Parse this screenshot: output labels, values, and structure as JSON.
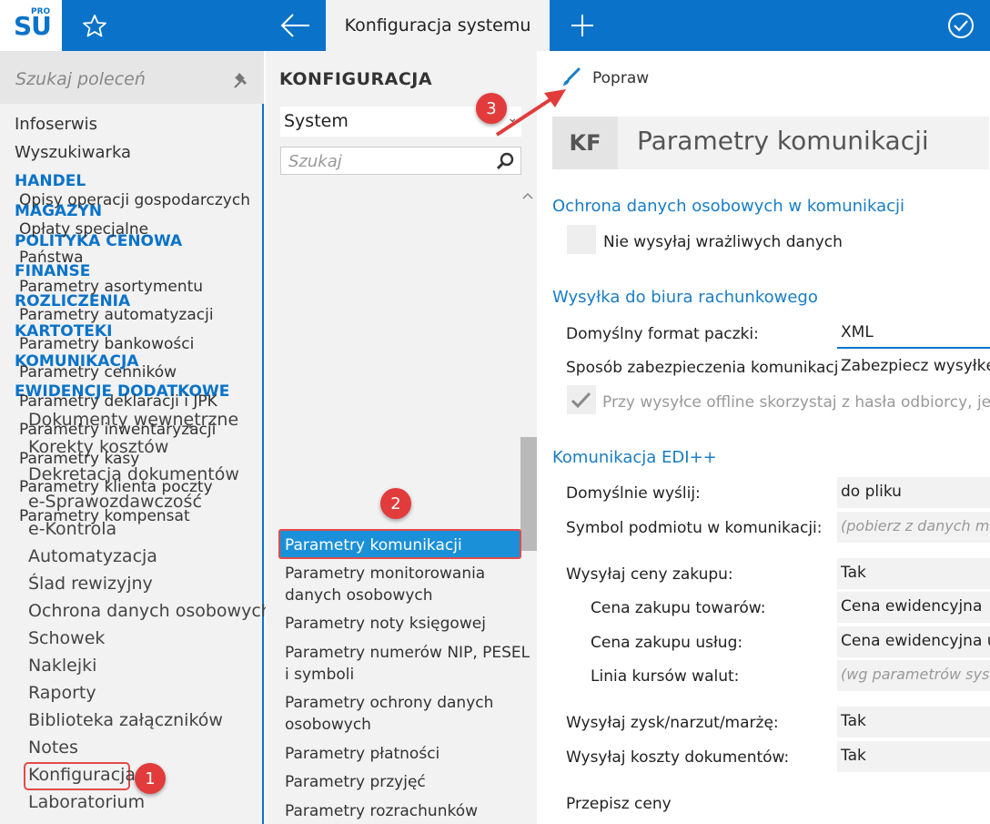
{
  "app": {
    "logo_text": "SU",
    "logo_badge": "PRO",
    "tab_title": "Konfiguracja systemu"
  },
  "icons": {
    "favorite": "star-icon",
    "back": "arrow-left-icon",
    "new_tab": "plus-icon",
    "confirm": "check-circle-icon",
    "pin": "pin-icon",
    "search": "magnifier-icon",
    "edit": "brush-icon"
  },
  "colors": {
    "accent": "#0a73c9",
    "selected": "#1a90d9",
    "annotation": "#e23b3b"
  },
  "sidebar": {
    "search_placeholder": "Szukaj poleceń",
    "items": [
      {
        "label": "Infoserwis",
        "kind": "plain"
      },
      {
        "label": "Wyszukiwarka",
        "kind": "plain"
      },
      {
        "label": "HANDEL",
        "kind": "head"
      },
      {
        "label": "MAGAZYN",
        "kind": "head"
      },
      {
        "label": "POLITYKA CENOWA",
        "kind": "head"
      },
      {
        "label": "FINANSE",
        "kind": "head"
      },
      {
        "label": "ROZLICZENIA",
        "kind": "head"
      },
      {
        "label": "KARTOTEKI",
        "kind": "head"
      },
      {
        "label": "KOMUNIKACJA",
        "kind": "head"
      },
      {
        "label": "EWIDENCJE DODATKOWE",
        "kind": "head"
      }
    ],
    "subitems": [
      "Dokumenty wewnętrzne",
      "Korekty kosztów",
      "Dekretacja dokumentów",
      "e-Sprawozdawczość",
      "e-Kontrola",
      "Automatyzacja",
      "Ślad rewizyjny",
      "Ochrona danych osobowych",
      "Schowek",
      "Naklejki",
      "Raporty",
      "Biblioteka załączników",
      "Notes",
      "Konfiguracja",
      "Laboratorium"
    ]
  },
  "config_panel": {
    "title": "KONFIGURACJA",
    "selected_group": "System",
    "search_placeholder": "Szukaj",
    "items": [
      "Opisy operacji gospodarczych",
      "Opłaty specjalne",
      "Państwa",
      "Parametry asortymentu",
      "Parametry automatyzacji",
      "Parametry bankowości",
      "Parametry cenników",
      "Parametry deklaracji i JPK",
      "Parametry inwentaryzacji",
      "Parametry kasy",
      "Parametry klienta poczty",
      "Parametry kompensat",
      "Parametry komunikacji",
      "Parametry monitorowania",
      "danych osobowych",
      "Parametry noty księgowej",
      "Parametry numerów NIP, PESEL",
      "i symboli",
      "Parametry ochrony danych",
      "osobowych",
      "Parametry płatności",
      "Parametry przyjęć",
      "Parametry rozrachunków"
    ],
    "selected_index": 12
  },
  "main": {
    "toolbar_edit": "Popraw",
    "badge": "KF",
    "title": "Parametry komunikacji",
    "sections": {
      "s1": "Ochrona danych osobowych w komunikacji",
      "s2": "Wysyłka do biura rachunkowego",
      "s3": "Komunikacja EDI++"
    },
    "cb_sensitive": "Nie wysyłaj wrażliwych danych",
    "cb_offline": "Przy wysyłce offline skorzystaj z hasła odbiorcy, jeśli p",
    "fields": {
      "format_label": "Domyślny format paczki:",
      "format_value": "XML",
      "secure_label": "Sposób zabezpieczenia komunikacji:",
      "secure_value": "Zabezpiecz wysyłkę t",
      "send_label": "Domyślnie wyślij:",
      "send_value": "do pliku",
      "symbol_label": "Symbol podmiotu w komunikacji:",
      "symbol_value": "(pobierz z danych mo",
      "prices_label": "Wysyłaj ceny zakupu:",
      "prices_value": "Tak",
      "goods_label": "Cena zakupu towarów:",
      "goods_value": "Cena ewidencyjna",
      "services_label": "Cena zakupu usług:",
      "services_value": "Cena ewidencyjna us",
      "rates_label": "Linia kursów walut:",
      "rates_value": "(wg parametrów syste",
      "profit_label": "Wysyłaj zysk/narzut/marżę:",
      "profit_value": "Tak",
      "costs_label": "Wysyłaj koszty dokumentów:",
      "costs_value": "Tak",
      "rewrite_label": "Przepisz ceny"
    }
  },
  "annotations": {
    "m1": "1",
    "m2": "2",
    "m3": "3"
  }
}
